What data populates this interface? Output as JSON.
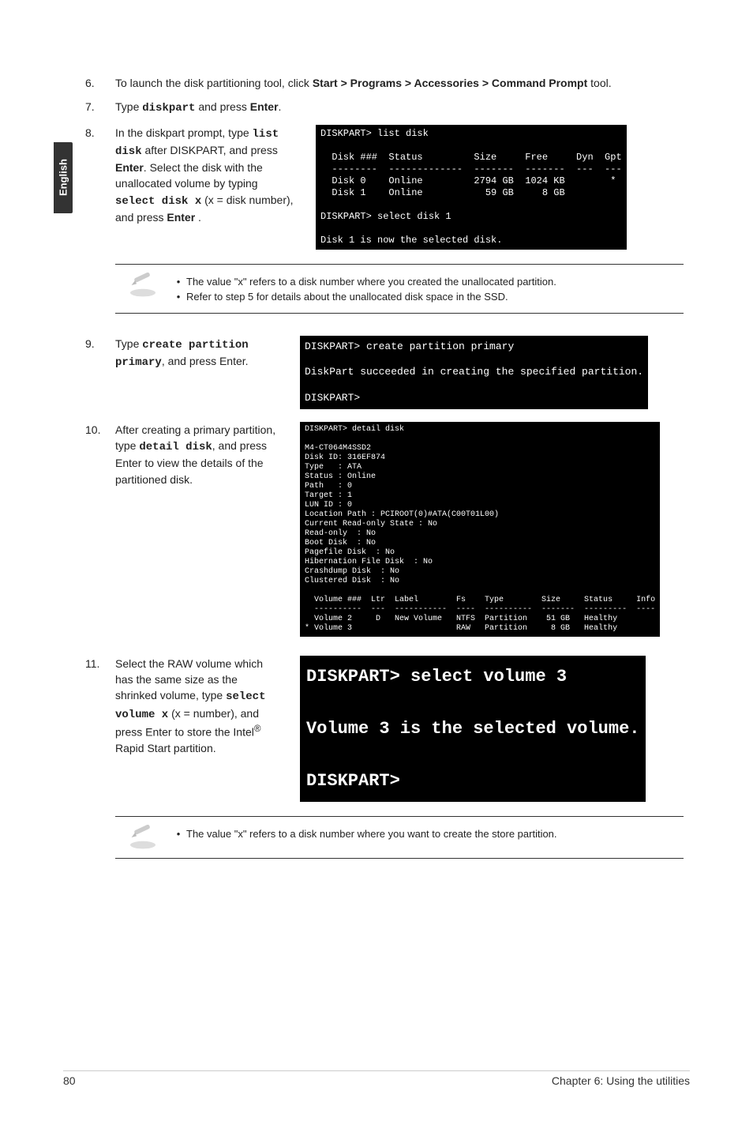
{
  "side_tab": "English",
  "steps": {
    "s6": {
      "num": "6.",
      "pre": "To launch the disk partitioning tool, click ",
      "bold": "Start > Programs > Accessories > Command Prompt",
      "post": " tool."
    },
    "s7": {
      "num": "7.",
      "pre": "Type ",
      "mono": "diskpart",
      "mid": " and press ",
      "bold": "Enter",
      "post": "."
    },
    "s8": {
      "num": "8.",
      "p1a": "In the diskpart prompt, type ",
      "p1mono": "list disk",
      "p1b": " after DISKPART, and press ",
      "p1bold": "Enter",
      "p1c": ". Select the disk with the unallocated volume by typing ",
      "p2mono": "select disk x",
      "p2a": " (x = disk number), and press ",
      "p2bold": "Enter",
      "p2b": " ."
    },
    "s9": {
      "num": "9.",
      "pre": "Type ",
      "mono": "create partition primary",
      "mid": ", and press ",
      "bold": "Enter."
    },
    "s10": {
      "num": "10.",
      "p1": "After creating a primary partition, type ",
      "mono": "detail disk",
      "p2": ", and press ",
      "bold": "Enter",
      "p3": " to view the details of the partitioned disk."
    },
    "s11": {
      "num": "11.",
      "p1": "Select the RAW volume which has the same size as the shrinked volume, type ",
      "mono": "select volume x",
      "p2": " (x = number), and press ",
      "bold": "Enter",
      "p3": " to store the Intel",
      "sup": "®",
      "p4": " Rapid Start partition."
    }
  },
  "term_listdisk": "DISKPART> list disk\n\n  Disk ###  Status         Size     Free     Dyn  Gpt\n  --------  -------------  -------  -------  ---  ---\n  Disk 0    Online         2794 GB  1024 KB        *\n  Disk 1    Online           59 GB     8 GB\n\nDISKPART> select disk 1\n\nDisk 1 is now the selected disk.",
  "term_create": "DISKPART> create partition primary\n\nDiskPart succeeded in creating the specified partition.\n\nDISKPART>",
  "term_detail": "DISKPART> detail disk\n\nM4-CT064M4SSD2\nDisk ID: 316EF874\nType   : ATA\nStatus : Online\nPath   : 0\nTarget : 1\nLUN ID : 0\nLocation Path : PCIROOT(0)#ATA(C00T01L00)\nCurrent Read-only State : No\nRead-only  : No\nBoot Disk  : No\nPagefile Disk  : No\nHibernation File Disk  : No\nCrashdump Disk  : No\nClustered Disk  : No\n\n  Volume ###  Ltr  Label        Fs    Type        Size     Status     Info\n  ----------  ---  -----------  ----  ----------  -------  ---------  ----\n  Volume 2     D   New Volume   NTFS  Partition    51 GB   Healthy\n* Volume 3                      RAW   Partition     8 GB   Healthy",
  "term_select": "DISKPART> select volume 3\n\nVolume 3 is the selected volume.\n\nDISKPART>",
  "note1": {
    "b1a": "The value \"",
    "b1bold": "x",
    "b1b": "\" refers to a disk number where you created the unallocated partition.",
    "b2": "Refer to step 5 for details about the unallocated disk space in the SSD."
  },
  "note2": {
    "a": "The value \"",
    "bold": "x",
    "b": "\" refers to a disk number where you want to create the store partition."
  },
  "footer": {
    "left": "80",
    "right": "Chapter 6: Using the utilities"
  }
}
